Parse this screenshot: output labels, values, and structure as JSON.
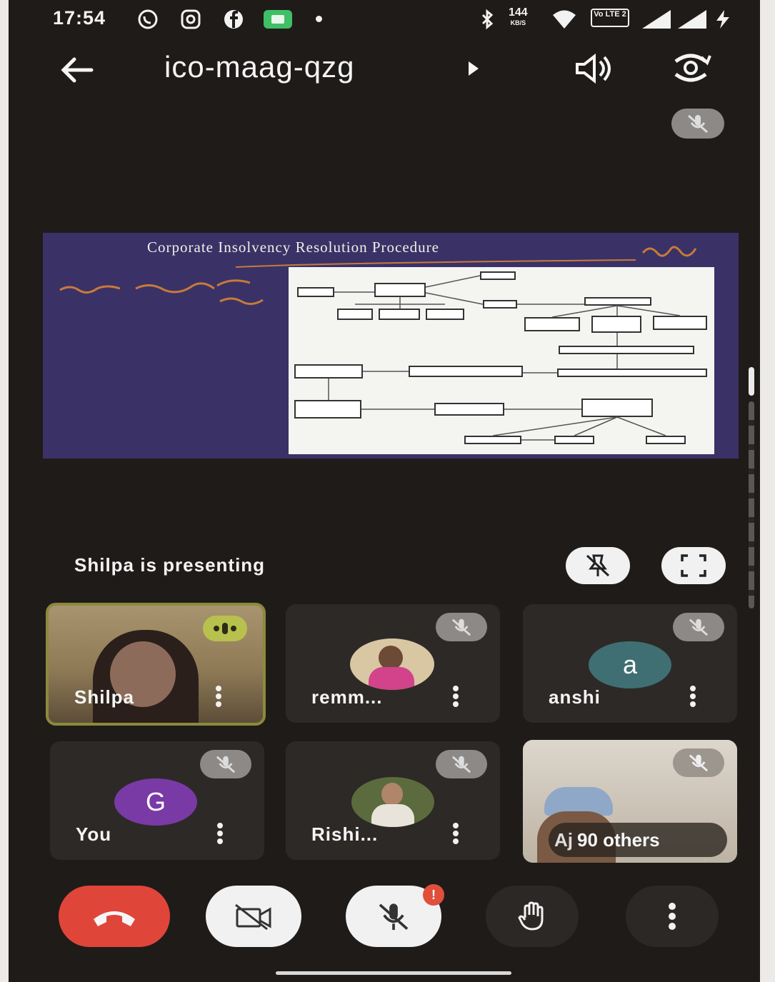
{
  "status_bar": {
    "time": "17:54",
    "network_speed_value": "144",
    "network_speed_unit": "KB/S",
    "lte_label": "Vo LTE 2"
  },
  "top_bar": {
    "meeting_code": "ico-maag-qzg",
    "back_icon": "arrow-left-icon",
    "speaker_icon": "speaker-icon",
    "switch_camera_icon": "switch-camera-icon"
  },
  "slide": {
    "title": "Corporate Insolvency Resolution Procedure"
  },
  "presenting": {
    "label": "Shilpa is presenting"
  },
  "participants": [
    {
      "name": "Shilpa",
      "speaking": true
    },
    {
      "name": "remm...",
      "muted": true
    },
    {
      "name": "anshi",
      "avatar_letter": "a",
      "avatar_color": "#3f6f73",
      "muted": true
    },
    {
      "name": "You",
      "avatar_letter": "G",
      "avatar_color": "#7a3aa5",
      "muted": true
    },
    {
      "name": "Rishi...",
      "muted": true
    },
    {
      "name": "Aj",
      "muted": true
    }
  ],
  "others": {
    "label": "90 others"
  },
  "controls": {
    "end_call_color": "#e0453a",
    "mic_alert": "!"
  }
}
